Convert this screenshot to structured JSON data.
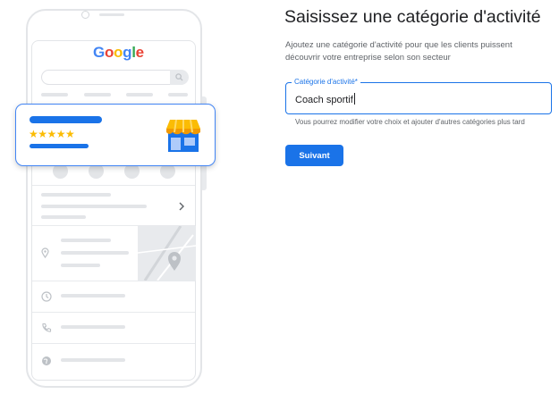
{
  "form": {
    "title": "Saisissez une catégorie d'activité",
    "description": "Ajoutez une catégorie d'activité pour que les clients puissent découvrir votre entreprise selon son secteur",
    "field_label": "Catégorie d'activité*",
    "field_value": "Coach sportif",
    "helper_text": "Vous pourrez modifier votre choix et ajouter d'autres catégories plus tard",
    "next_button": "Suivant"
  },
  "illustration": {
    "logo_letters": [
      "G",
      "o",
      "o",
      "g",
      "l",
      "e"
    ],
    "logo_colors": [
      "#4285f4",
      "#ea4335",
      "#fbbc04",
      "#4285f4",
      "#34a853",
      "#ea4335"
    ],
    "stars": "★★★★★",
    "star_color": "#fbbc04",
    "accent": "#1a73e8"
  }
}
